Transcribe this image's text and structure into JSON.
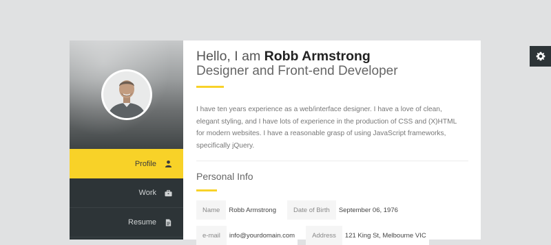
{
  "header": {
    "greeting": "Hello, I am",
    "name": "Robb Armstrong",
    "subtitle": "Designer and Front-end Developer"
  },
  "bio": "I have ten years experience as a web/interface designer. I have a love of clean, elegant styling, and I have lots of experience in the production of CSS and (X)HTML for modern websites. I have a reasonable grasp of using JavaScript frameworks, specifically jQuery.",
  "sidebar": {
    "avatar_icon": "person-portrait",
    "items": [
      {
        "label": "Profile",
        "icon": "user-icon",
        "active": true
      },
      {
        "label": "Work",
        "icon": "briefcase-icon",
        "active": false
      },
      {
        "label": "Resume",
        "icon": "document-icon",
        "active": false
      }
    ]
  },
  "personal_info": {
    "title": "Personal Info",
    "fields": [
      {
        "label": "Name",
        "value": "Robb Armstrong"
      },
      {
        "label": "Date of Birth",
        "value": "September 06, 1976"
      },
      {
        "label": "e-mail",
        "value": "info@yourdomain.com"
      },
      {
        "label": "Address",
        "value": "121 King St, Melbourne VIC"
      }
    ]
  },
  "settings": {
    "icon": "gear-icon"
  },
  "colors": {
    "accent": "#f8d228",
    "sidebar": "#2d3437",
    "background": "#e0e1e2"
  }
}
